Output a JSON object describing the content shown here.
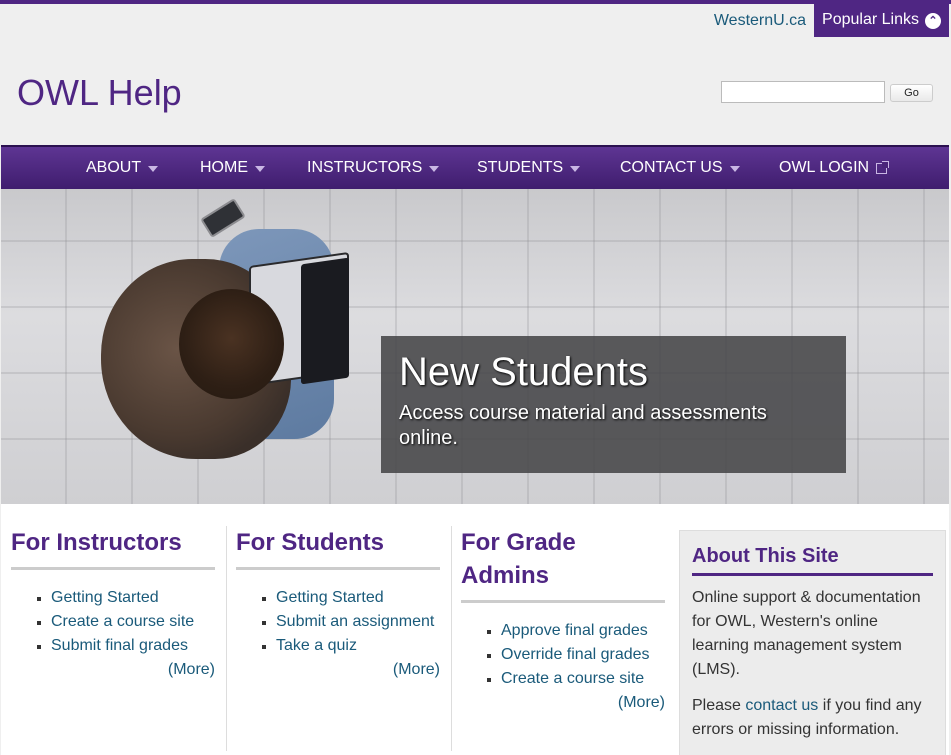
{
  "utility": {
    "western_link": "WesternU.ca",
    "popular_links": "Popular Links"
  },
  "site": {
    "title": "OWL Help"
  },
  "search": {
    "value": "",
    "go_label": "Go"
  },
  "nav": {
    "items": [
      {
        "label": "ABOUT"
      },
      {
        "label": "HOME"
      },
      {
        "label": "INSTRUCTORS"
      },
      {
        "label": "STUDENTS"
      },
      {
        "label": "CONTACT US"
      },
      {
        "label": "OWL LOGIN"
      }
    ]
  },
  "hero": {
    "title": "New Students",
    "text": "Access course material and assessments online."
  },
  "instructors": {
    "heading": "For Instructors",
    "links": [
      "Getting Started",
      "Create a course site",
      "Submit final grades"
    ],
    "more": "(More)"
  },
  "students": {
    "heading": "For Students",
    "links": [
      "Getting Started",
      "Submit an assignment",
      "Take a quiz"
    ],
    "more": "(More)"
  },
  "grade_admins": {
    "heading": "For Grade Admins",
    "links": [
      "Approve final grades",
      "Override final grades",
      "Create a course site"
    ],
    "more": "(More)"
  },
  "about": {
    "heading": "About This Site",
    "description": "Online support & documentation for OWL, Western's online learning management system (LMS).",
    "contact_prefix": "Please ",
    "contact_link": "contact us",
    "contact_suffix": " if you find any errors or missing information."
  },
  "colors": {
    "brand_purple": "#4f2683",
    "link_blue": "#1a5a7a"
  }
}
